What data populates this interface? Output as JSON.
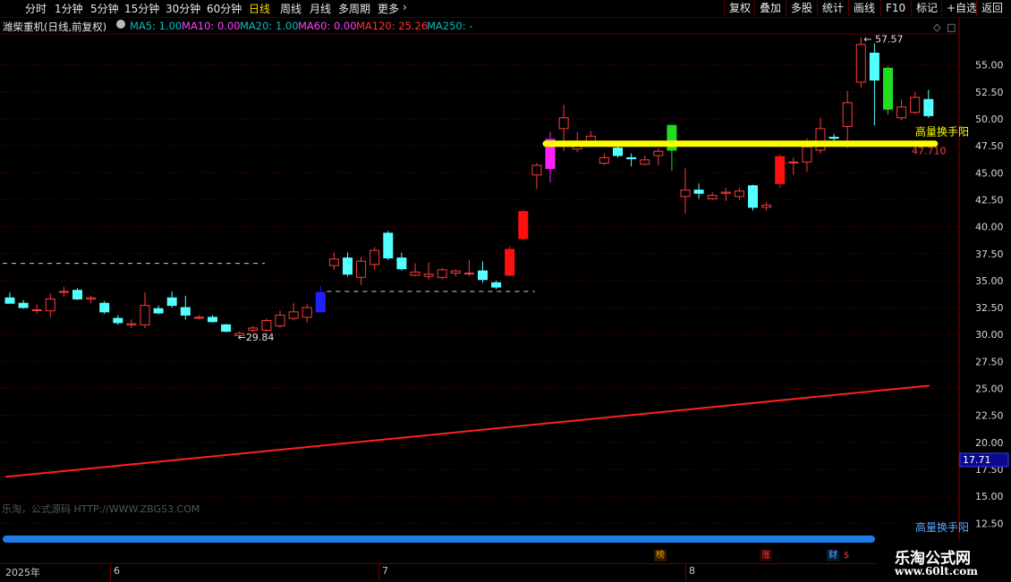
{
  "toolbar": {
    "periods": [
      "分时",
      "1分钟",
      "5分钟",
      "15分钟",
      "30分钟",
      "60分钟",
      "日线",
      "周线",
      "月线",
      "多周期",
      "更多"
    ],
    "active_period": "日线",
    "tools": [
      "复权",
      "叠加",
      "多股",
      "统计",
      "画线",
      "F10",
      "标记",
      "+自选",
      "返回"
    ]
  },
  "info": {
    "title": "潍柴重机(日线,前复权)",
    "ma_items": [
      {
        "label": "MA5: 1.00",
        "color": "#00bfbf"
      },
      {
        "label": "MA10: 0.00",
        "color": "#ff40ff"
      },
      {
        "label": "MA20: 1.00",
        "color": "#00bfbf"
      },
      {
        "label": "MA60: 0.00",
        "color": "#ff40ff"
      },
      {
        "label": "MA120: 25.26",
        "color": "#ff3030"
      },
      {
        "label": "MA250: -",
        "color": "#00bfbf"
      }
    ],
    "corner_icons": [
      "diamond-icon",
      "square-icon"
    ]
  },
  "chart_data": {
    "type": "candlestick",
    "y_axis": {
      "min": 12.5,
      "max": 57.5,
      "ticks": [
        55.0,
        52.5,
        50.0,
        47.5,
        45.0,
        42.5,
        40.0,
        37.5,
        35.0,
        32.5,
        30.0,
        27.5,
        25.0,
        22.5,
        20.0,
        17.5,
        15.0,
        12.5
      ]
    },
    "x_labels": [
      {
        "label": "2025年",
        "index": 0
      },
      {
        "label": "6",
        "index": 8
      },
      {
        "label": "7",
        "index": 28
      },
      {
        "label": "8",
        "index": 51
      }
    ],
    "candles": [
      {
        "o": 33.4,
        "h": 33.9,
        "l": 32.9,
        "c": 32.9
      },
      {
        "o": 32.9,
        "h": 33.2,
        "l": 32.4,
        "c": 32.5
      },
      {
        "o": 32.3,
        "h": 32.8,
        "l": 31.9,
        "c": 32.3
      },
      {
        "o": 32.2,
        "h": 33.8,
        "l": 31.6,
        "c": 33.3
      },
      {
        "o": 34.0,
        "h": 34.4,
        "l": 33.5,
        "c": 34.0
      },
      {
        "o": 34.1,
        "h": 34.3,
        "l": 33.2,
        "c": 33.3
      },
      {
        "o": 33.3,
        "h": 33.6,
        "l": 32.9,
        "c": 33.4
      },
      {
        "o": 32.9,
        "h": 33.1,
        "l": 31.9,
        "c": 32.1
      },
      {
        "o": 31.5,
        "h": 31.8,
        "l": 30.9,
        "c": 31.1
      },
      {
        "o": 30.9,
        "h": 31.4,
        "l": 30.6,
        "c": 31.0
      },
      {
        "o": 30.9,
        "h": 33.9,
        "l": 30.6,
        "c": 32.7
      },
      {
        "o": 32.4,
        "h": 32.7,
        "l": 31.9,
        "c": 32.0
      },
      {
        "o": 33.4,
        "h": 34.0,
        "l": 32.5,
        "c": 32.7
      },
      {
        "o": 32.5,
        "h": 33.6,
        "l": 31.4,
        "c": 31.8
      },
      {
        "o": 31.6,
        "h": 31.8,
        "l": 31.4,
        "c": 31.6
      },
      {
        "o": 31.6,
        "h": 31.8,
        "l": 31.1,
        "c": 31.2
      },
      {
        "o": 30.9,
        "h": 31.0,
        "l": 30.2,
        "c": 30.3
      },
      {
        "o": 29.9,
        "h": 30.3,
        "l": 29.84,
        "c": 30.1
      },
      {
        "o": 30.4,
        "h": 30.8,
        "l": 30.2,
        "c": 30.6
      },
      {
        "o": 30.4,
        "h": 31.5,
        "l": 30.2,
        "c": 31.3
      },
      {
        "o": 30.8,
        "h": 32.2,
        "l": 30.6,
        "c": 31.8
      },
      {
        "o": 31.5,
        "h": 32.9,
        "l": 31.3,
        "c": 32.1
      },
      {
        "o": 31.6,
        "h": 32.8,
        "l": 31.1,
        "c": 32.5
      },
      {
        "o": 32.1,
        "h": 34.5,
        "l": 32.1,
        "c": 33.9,
        "color": "#2020ff"
      },
      {
        "o": 36.4,
        "h": 37.6,
        "l": 36.0,
        "c": 37.0
      },
      {
        "o": 37.1,
        "h": 37.6,
        "l": 35.4,
        "c": 35.6
      },
      {
        "o": 35.3,
        "h": 37.2,
        "l": 34.6,
        "c": 36.8
      },
      {
        "o": 36.5,
        "h": 38.1,
        "l": 36.0,
        "c": 37.8
      },
      {
        "o": 39.4,
        "h": 39.6,
        "l": 36.9,
        "c": 37.1
      },
      {
        "o": 37.1,
        "h": 37.6,
        "l": 35.9,
        "c": 36.1
      },
      {
        "o": 35.5,
        "h": 36.6,
        "l": 35.4,
        "c": 35.8
      },
      {
        "o": 35.4,
        "h": 36.7,
        "l": 35.1,
        "c": 35.6
      },
      {
        "o": 35.3,
        "h": 36.2,
        "l": 35.1,
        "c": 36.0
      },
      {
        "o": 35.7,
        "h": 36.0,
        "l": 35.4,
        "c": 35.9
      },
      {
        "o": 35.7,
        "h": 36.9,
        "l": 35.4,
        "c": 35.7
      },
      {
        "o": 35.9,
        "h": 36.8,
        "l": 34.8,
        "c": 35.1
      },
      {
        "o": 34.8,
        "h": 35.0,
        "l": 34.2,
        "c": 34.4
      },
      {
        "o": 35.5,
        "h": 38.2,
        "l": 35.4,
        "c": 37.9,
        "color": "#ff1010"
      },
      {
        "o": 38.9,
        "h": 41.6,
        "l": 38.7,
        "c": 41.4,
        "color": "#ff1010"
      },
      {
        "o": 44.8,
        "h": 45.9,
        "l": 43.5,
        "c": 45.7
      },
      {
        "o": 45.4,
        "h": 48.8,
        "l": 44.1,
        "c": 48.1,
        "color": "#ff20ff"
      },
      {
        "o": 49.1,
        "h": 51.3,
        "l": 47.0,
        "c": 50.1
      },
      {
        "o": 47.2,
        "h": 48.8,
        "l": 46.9,
        "c": 47.6
      },
      {
        "o": 47.6,
        "h": 48.9,
        "l": 47.4,
        "c": 48.4
      },
      {
        "o": 45.9,
        "h": 46.8,
        "l": 45.7,
        "c": 46.4
      },
      {
        "o": 47.3,
        "h": 47.8,
        "l": 46.4,
        "c": 46.6
      },
      {
        "o": 46.4,
        "h": 46.8,
        "l": 45.6,
        "c": 46.3
      },
      {
        "o": 45.8,
        "h": 46.6,
        "l": 45.7,
        "c": 46.2
      },
      {
        "o": 46.6,
        "h": 47.3,
        "l": 45.7,
        "c": 47.0
      },
      {
        "o": 47.1,
        "h": 48.9,
        "l": 45.2,
        "c": 49.4,
        "color": "#20dd20"
      },
      {
        "o": 42.8,
        "h": 45.4,
        "l": 41.2,
        "c": 43.4
      },
      {
        "o": 43.4,
        "h": 44.0,
        "l": 42.6,
        "c": 43.1
      },
      {
        "o": 42.6,
        "h": 43.2,
        "l": 42.5,
        "c": 42.9
      },
      {
        "o": 43.1,
        "h": 43.6,
        "l": 42.4,
        "c": 43.2
      },
      {
        "o": 42.8,
        "h": 43.6,
        "l": 42.5,
        "c": 43.3
      },
      {
        "o": 43.8,
        "h": 43.9,
        "l": 41.5,
        "c": 41.8
      },
      {
        "o": 41.8,
        "h": 42.3,
        "l": 41.5,
        "c": 42.0
      },
      {
        "o": 44.0,
        "h": 46.7,
        "l": 43.6,
        "c": 46.5,
        "color": "#ff1010"
      },
      {
        "o": 46.0,
        "h": 46.4,
        "l": 44.8,
        "c": 46.0
      },
      {
        "o": 46.0,
        "h": 48.2,
        "l": 45.1,
        "c": 47.4
      },
      {
        "o": 47.1,
        "h": 50.1,
        "l": 46.8,
        "c": 49.1
      },
      {
        "o": 48.3,
        "h": 48.6,
        "l": 48.0,
        "c": 48.2
      },
      {
        "o": 49.3,
        "h": 52.6,
        "l": 47.3,
        "c": 51.5
      },
      {
        "o": 53.4,
        "h": 57.57,
        "l": 52.9,
        "c": 56.9
      },
      {
        "o": 56.1,
        "h": 57.0,
        "l": 49.4,
        "c": 53.6
      },
      {
        "o": 54.7,
        "h": 54.9,
        "l": 50.4,
        "c": 50.9,
        "color": "#20dd20"
      },
      {
        "o": 50.1,
        "h": 51.8,
        "l": 49.9,
        "c": 51.1
      },
      {
        "o": 50.6,
        "h": 52.5,
        "l": 50.4,
        "c": 52.0
      },
      {
        "o": 51.8,
        "h": 52.7,
        "l": 50.1,
        "c": 50.3
      }
    ],
    "ma120": {
      "name": "MA120",
      "color": "#ff2020",
      "values": [
        16.8,
        25.26
      ]
    },
    "annotations": {
      "high": {
        "label": "57.57",
        "index": 63
      },
      "low": {
        "label": "29.84",
        "index": 17
      },
      "support_line_1": {
        "value": 36.6,
        "from": 0,
        "to": 19
      },
      "support_line_2": {
        "value": 34.0,
        "from": 24,
        "to": 39
      },
      "signal_line": {
        "value": 47.7,
        "from": 40,
        "to": 68,
        "color": "#ffff00"
      },
      "signal_label": "高量换手阳",
      "signal_value": "47.710"
    },
    "current_price_tag": "17.71",
    "bottom_label": "高量换手阳",
    "progress_bar_color": "#1e7be6"
  },
  "watermark": "乐淘，公式源码 HTTP://WWW.ZBGS3.COM",
  "logo": {
    "main": "乐淘公式网",
    "url": "www.60lt.com"
  },
  "badges": [
    {
      "label": "榜",
      "color": "#ff9900",
      "bg": "#2a1a00",
      "index": 48
    },
    {
      "label": "涨",
      "color": "#ff4040",
      "bg": "#2a0000",
      "index": 57
    },
    {
      "label": "财",
      "color": "#66aaff",
      "bg": "#001a33",
      "index": 61
    },
    {
      "label": "$",
      "color": "#ff3030",
      "bg": "#000000",
      "index": 62
    }
  ]
}
